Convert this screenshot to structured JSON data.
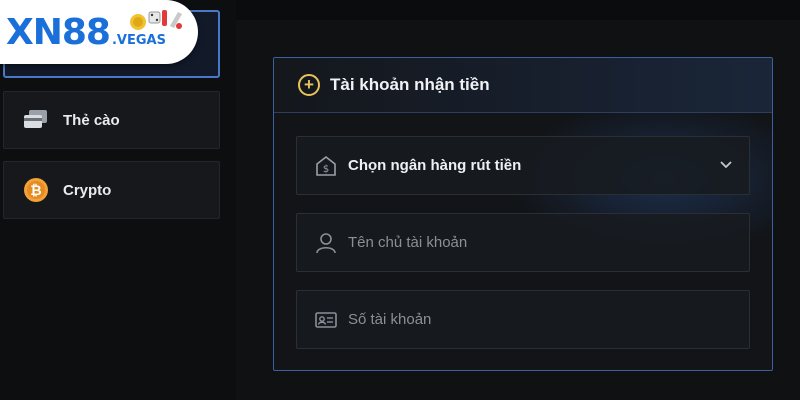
{
  "brand": {
    "logo_text": "XN88",
    "logo_sub": ".VEGAS",
    "color": "#1a6fd9"
  },
  "sidebar": {
    "items": [
      {
        "label": "Thẻ cào",
        "icon": "card-icon"
      },
      {
        "label": "Crypto",
        "icon": "bitcoin-icon"
      }
    ],
    "active_color": "#4a78c8"
  },
  "panel": {
    "title": "Tài khoản nhận tiền",
    "icon": "plus-circle-icon",
    "accent": "#e7c35a",
    "bank_select": {
      "label": "Chọn ngân hàng rút tiền",
      "icon": "bank-icon"
    },
    "account_name": {
      "placeholder": "Tên chủ tài khoản",
      "value": "",
      "icon": "user-icon"
    },
    "account_number": {
      "placeholder": "Số tài khoản",
      "value": "",
      "icon": "id-card-icon"
    }
  }
}
